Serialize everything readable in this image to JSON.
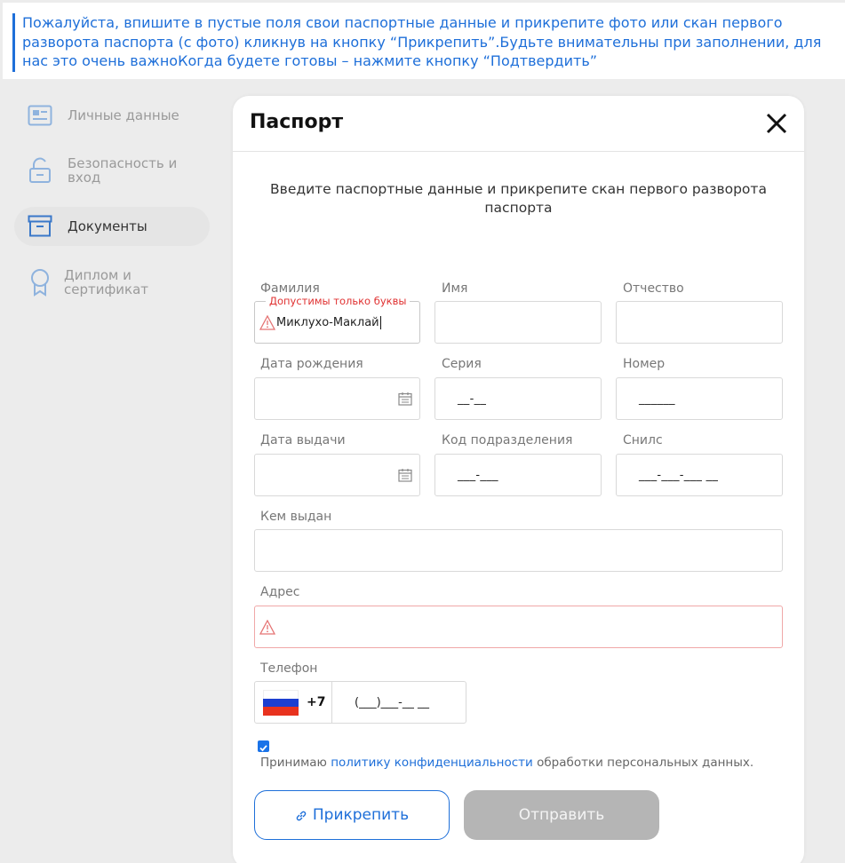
{
  "banner": {
    "text": "Пожалуйста, впишите в пустые поля свои паспортные данные и прикрепите фото или скан первого разворота паспорта (с фото) кликнув на кнопку “Прикрепить”.Будьте внимательны при заполнении, для нас это очень важноКогда будете готовы – нажмите кнопку “Подтвердить”"
  },
  "sidebar": {
    "items": [
      {
        "label": "Личные данные",
        "icon": "id-card-icon"
      },
      {
        "label": "Безопасность и вход",
        "icon": "unlock-icon"
      },
      {
        "label": "Документы",
        "icon": "archive-box-icon",
        "active": true
      },
      {
        "label": "Диплом и сертификат",
        "icon": "award-ribbon-icon"
      }
    ]
  },
  "modal": {
    "title": "Паспорт",
    "subtitle": "Введите паспортные данные и прикрепите скан первого разворота паспорта",
    "fields": {
      "surname": {
        "label": "Фамилия",
        "value": "Миклухо-Маклай",
        "error": "Допустимы только буквы"
      },
      "name": {
        "label": "Имя",
        "value": ""
      },
      "patronymic": {
        "label": "Отчество",
        "value": ""
      },
      "birth_date": {
        "label": "Дата рождения",
        "value": ""
      },
      "series": {
        "label": "Серия",
        "mask": "__-__"
      },
      "number": {
        "label": "Номер",
        "mask": "______"
      },
      "issue_date": {
        "label": "Дата выдачи",
        "value": ""
      },
      "division_code": {
        "label": "Код подразделения",
        "mask": "___-___"
      },
      "snils": {
        "label": "Снилс",
        "mask": "___-___-___ __"
      },
      "issued_by": {
        "label": "Кем выдан",
        "value": ""
      },
      "address": {
        "label": "Адрес",
        "value": ""
      },
      "phone": {
        "label": "Телефон",
        "code": "+7",
        "mask": "(___)___-__ __"
      }
    },
    "consent": {
      "checked": true,
      "prefix": "Принимаю ",
      "link": "политику конфиденциальности",
      "suffix": " обработки персональных данных."
    },
    "buttons": {
      "attach": "Прикрепить",
      "send": "Отправить"
    }
  },
  "colors": {
    "accent": "#1e6fd9",
    "error": "#e03131",
    "disabled": "#b5b5b5"
  }
}
